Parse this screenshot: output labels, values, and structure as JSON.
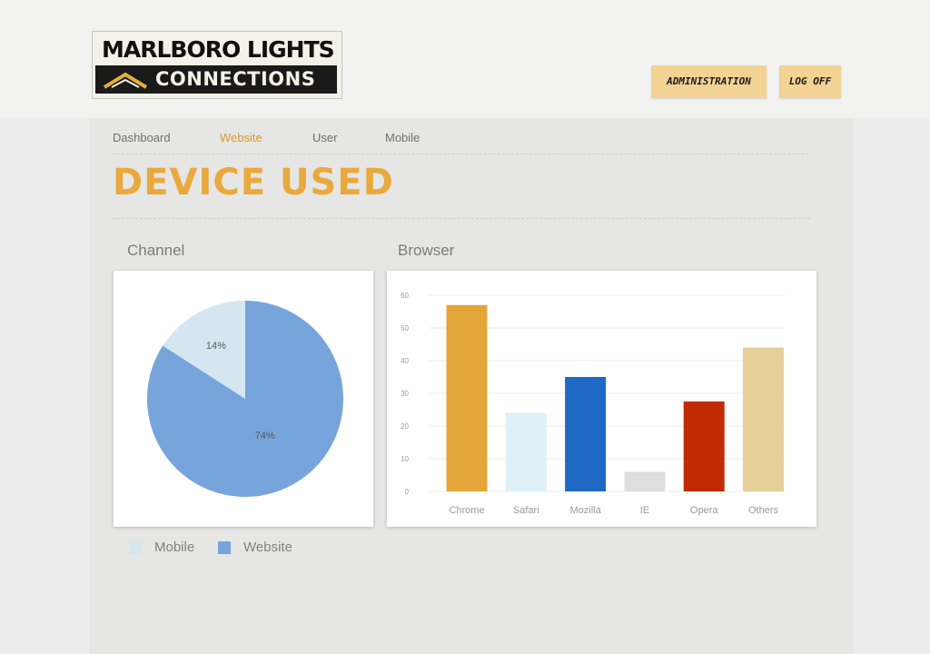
{
  "logo": {
    "top_text": "MARLBORO LIGHTS",
    "bottom_text": "CONNECTIONS"
  },
  "header": {
    "admin_label": "ADMINISTRATION",
    "logoff_label": "LOG OFF"
  },
  "nav": {
    "items": [
      {
        "label": "Dashboard",
        "active": false
      },
      {
        "label": "Website",
        "active": true
      },
      {
        "label": "User",
        "active": false
      },
      {
        "label": "Mobile",
        "active": false
      }
    ]
  },
  "page_title": "DEVICE USED",
  "sections": {
    "channel": "Channel",
    "browser": "Browser"
  },
  "colors": {
    "accent": "#e9a93d",
    "mobile": "#d6e6f1",
    "website": "#78a4dc"
  },
  "chart_data": [
    {
      "type": "pie",
      "title": "Channel",
      "slices": [
        {
          "name": "Mobile",
          "value": 14,
          "label": "14%",
          "color": "#d6e6f1"
        },
        {
          "name": "Website",
          "value": 74,
          "label": "74%",
          "color": "#78a4dc"
        }
      ],
      "legend": [
        {
          "name": "Mobile",
          "color": "#d6e6f1"
        },
        {
          "name": "Website",
          "color": "#78a4dc"
        }
      ],
      "legend_position": "bottom"
    },
    {
      "type": "bar",
      "title": "Browser",
      "categories": [
        "Chrome",
        "Safari",
        "Mozilla",
        "IE",
        "Opera",
        "Others"
      ],
      "values": [
        57,
        24,
        35,
        6,
        27.5,
        44
      ],
      "colors": [
        "#e4a638",
        "#dff0f8",
        "#1f68c4",
        "#dedede",
        "#c02b04",
        "#e6cf98"
      ],
      "yticks": [
        "0",
        "10",
        "20",
        "30",
        "40",
        "50",
        "60"
      ],
      "ylim": [
        0,
        60
      ],
      "grid": true
    }
  ]
}
